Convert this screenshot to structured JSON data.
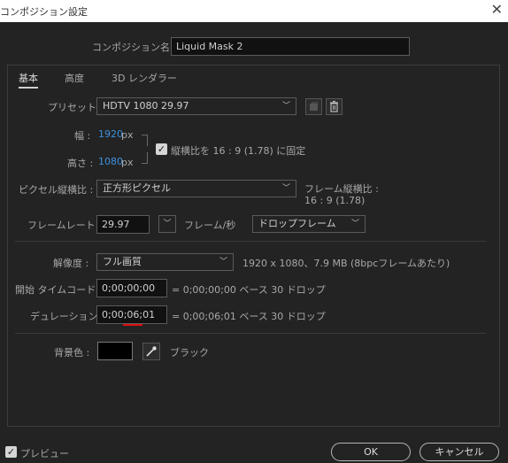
{
  "window": {
    "title": "コンポジション設定",
    "close_icon": "close-icon"
  },
  "comp_name": {
    "label": "コンポジション名 :",
    "value": "Liquid Mask 2"
  },
  "tabs": [
    {
      "label": "基本"
    },
    {
      "label": "高度"
    },
    {
      "label": "3D レンダラー"
    }
  ],
  "preset": {
    "label": "プリセット :",
    "value": "HDTV 1080 29.97"
  },
  "width": {
    "label": "幅 :",
    "value": "1920",
    "unit": "px"
  },
  "height": {
    "label": "高さ :",
    "value": "1080",
    "unit": "px"
  },
  "aspect_lock": {
    "label": "縦横比を 16 : 9 (1.78) に固定",
    "checked": true
  },
  "pixel_aspect": {
    "label": "ピクセル縦横比 :",
    "value": "正方形ピクセル",
    "frame_aspect_label": "フレーム縦横比 :",
    "frame_aspect_value": "16 : 9 (1.78)"
  },
  "frame_rate": {
    "label": "フレームレート :",
    "value": "29.97",
    "unit": "フレーム/秒",
    "drop": "ドロップフレーム"
  },
  "resolution": {
    "label": "解像度 :",
    "value": "フル画質",
    "info": "1920 x 1080、7.9 MB (8bpcフレームあたり)"
  },
  "start_timecode": {
    "label": "開始 タイムコード :",
    "value": "0;00;00;00",
    "info": "= 0;00;00;00  ベース 30  ドロップ"
  },
  "duration": {
    "label": "デュレーション :",
    "value": "0;00;06;01",
    "info": "= 0;00;06;01  ベース 30  ドロップ"
  },
  "bg_color": {
    "label": "背景色 :",
    "name": "ブラック",
    "swatch": "#000000"
  },
  "footer": {
    "preview_label": "プレビュー",
    "ok": "OK",
    "cancel": "キャンセル"
  },
  "colors": {
    "accent_blue": "#3d92e0",
    "underline_red": "#e01010"
  }
}
